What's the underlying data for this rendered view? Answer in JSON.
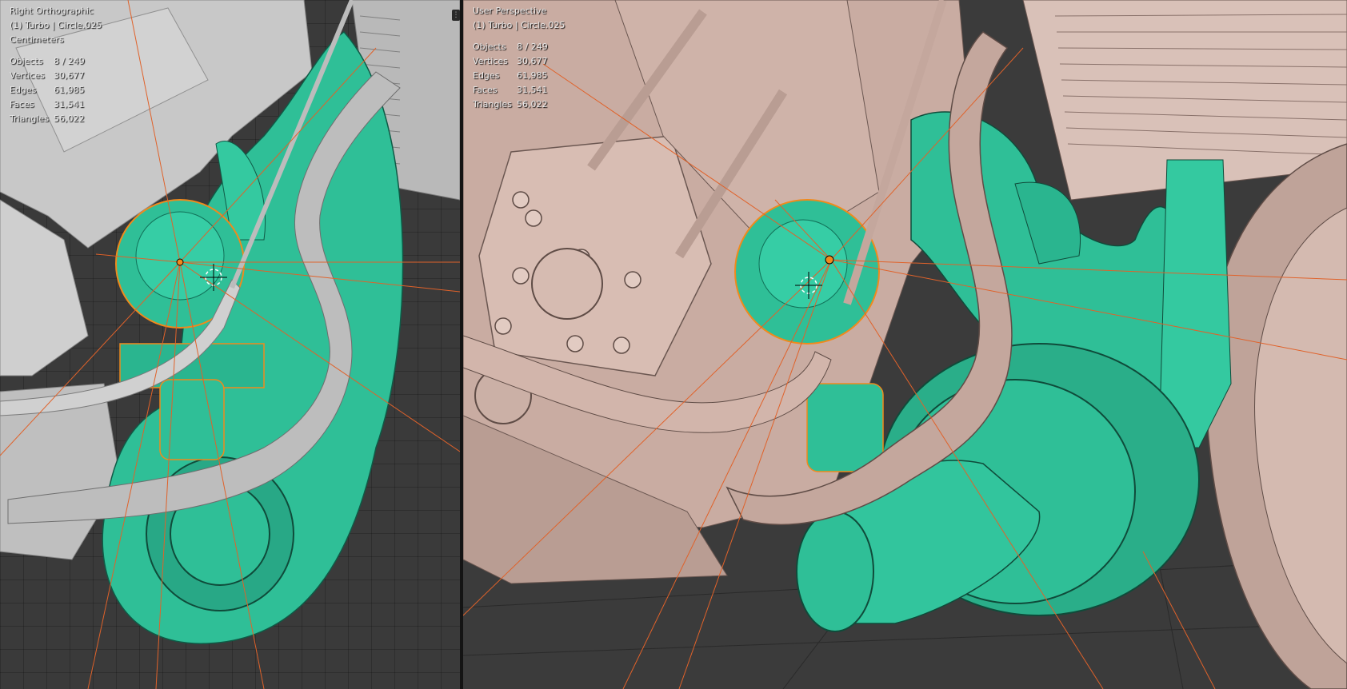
{
  "left_viewport": {
    "view_name": "Right Orthographic",
    "object_info": "(1) Turbo | Circle.025",
    "units": "Centimeters",
    "stats": [
      {
        "label": "Objects",
        "value": "8 / 249"
      },
      {
        "label": "Vertices",
        "value": "30,677"
      },
      {
        "label": "Edges",
        "value": "61,985"
      },
      {
        "label": "Faces",
        "value": "31,541"
      },
      {
        "label": "Triangles",
        "value": "56,022"
      }
    ]
  },
  "right_viewport": {
    "view_name": "User Perspective",
    "object_info": "(1) Turbo | Circle.025",
    "stats": [
      {
        "label": "Objects",
        "value": "8 / 249"
      },
      {
        "label": "Vertices",
        "value": "30,677"
      },
      {
        "label": "Edges",
        "value": "61,985"
      },
      {
        "label": "Faces",
        "value": "31,541"
      },
      {
        "label": "Triangles",
        "value": "56,022"
      }
    ]
  },
  "icons": {
    "area_split": "area-split-icon",
    "cursor": "3d-cursor-icon"
  },
  "colors": {
    "selected_mesh": "#2fbf97",
    "unselected_mesh": "#c9c9c9",
    "perspective_mesh": "#c9aca2",
    "selection_outline": "#f08a1c",
    "light_lines": "#e0622a",
    "background": "#3a3a3a"
  }
}
